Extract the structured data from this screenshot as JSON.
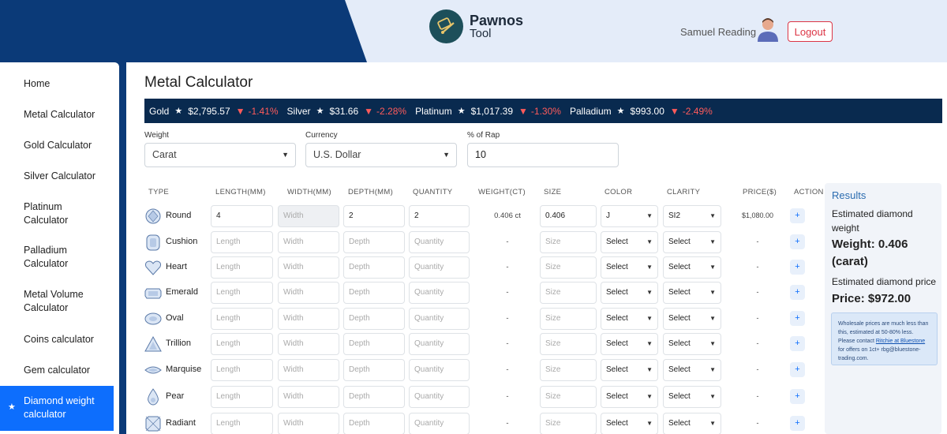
{
  "header": {
    "brand_name": "Pawnos",
    "brand_sub": "Tool",
    "user_name": "Samuel Reading",
    "logout_label": "Logout",
    "colors": {
      "dark_navy": "#0b3a78",
      "light_bg": "#e4ecf9",
      "logout_red": "#dc3545"
    }
  },
  "sidebar": {
    "items": [
      {
        "label": "Home"
      },
      {
        "label": "Metal Calculator"
      },
      {
        "label": "Gold Calculator"
      },
      {
        "label": "Silver Calculator"
      },
      {
        "label": "Platinum Calculator"
      },
      {
        "label": "Palladium Calculator"
      },
      {
        "label": "Metal Volume Calculator"
      },
      {
        "label": "Coins calculator"
      },
      {
        "label": "Gem calculator"
      },
      {
        "label": "Diamond weight calculator",
        "active": true,
        "icon": "star-icon"
      }
    ]
  },
  "page": {
    "title": "Metal Calculator"
  },
  "ticker": [
    {
      "metal": "Gold",
      "price": "$2,795.57",
      "change": "-1.41%"
    },
    {
      "metal": "Silver",
      "price": "$31.66",
      "change": "-2.28%"
    },
    {
      "metal": "Platinum",
      "price": "$1,017.39",
      "change": "-1.30%"
    },
    {
      "metal": "Palladium",
      "price": "$993.00",
      "change": "-2.49%"
    }
  ],
  "filters": {
    "weight": {
      "label": "Weight",
      "value": "Carat"
    },
    "currency": {
      "label": "Currency",
      "value": "U.S. Dollar"
    },
    "rap": {
      "label": "% of Rap",
      "value": "10"
    }
  },
  "table": {
    "headers": [
      "TYPE",
      "LENGTH(MM)",
      "WIDTH(MM)",
      "DEPTH(MM)",
      "QUANTITY",
      "WEIGHT(CT)",
      "SIZE",
      "COLOR",
      "CLARITY",
      "PRICE($)",
      "ACTION"
    ],
    "placeholders": {
      "length": "Length",
      "width": "Width",
      "depth": "Depth",
      "quantity": "Quantity",
      "size": "Size",
      "select": "Select"
    },
    "action_label": "+",
    "rows": [
      {
        "type": "Round",
        "icon": "round-diamond-icon",
        "length": "4",
        "width": "",
        "depth": "2",
        "quantity": "2",
        "weight": "0.406 ct",
        "size": "0.406",
        "color": "J",
        "clarity": "SI2",
        "price": "$1,080.00",
        "filled": true
      },
      {
        "type": "Cushion",
        "icon": "cushion-diamond-icon",
        "weight": "-",
        "price": "-"
      },
      {
        "type": "Heart",
        "icon": "heart-diamond-icon",
        "weight": "-",
        "price": "-"
      },
      {
        "type": "Emerald",
        "icon": "emerald-diamond-icon",
        "weight": "-",
        "price": "-"
      },
      {
        "type": "Oval",
        "icon": "oval-diamond-icon",
        "weight": "-",
        "price": "-"
      },
      {
        "type": "Trillion",
        "icon": "trillion-diamond-icon",
        "weight": "-",
        "price": "-"
      },
      {
        "type": "Marquise",
        "icon": "marquise-diamond-icon",
        "weight": "-",
        "price": "-"
      },
      {
        "type": "Pear",
        "icon": "pear-diamond-icon",
        "weight": "-",
        "price": "-"
      },
      {
        "type": "Radiant",
        "icon": "radiant-diamond-icon",
        "weight": "-",
        "price": "-"
      }
    ]
  },
  "results": {
    "title": "Results",
    "weight_label": "Estimated diamond weight",
    "weight_value": "Weight: 0.406 (carat)",
    "price_label": "Estimated diamond price",
    "price_value": "Price: $972.00",
    "note_before": "Wholesale prices are much less than this, estimated at 50-80% less. Please contact ",
    "note_link": "Ritchie at Bluestone",
    "note_after": " for offers on 1ct+ rbg@bluestone-trading.com."
  }
}
